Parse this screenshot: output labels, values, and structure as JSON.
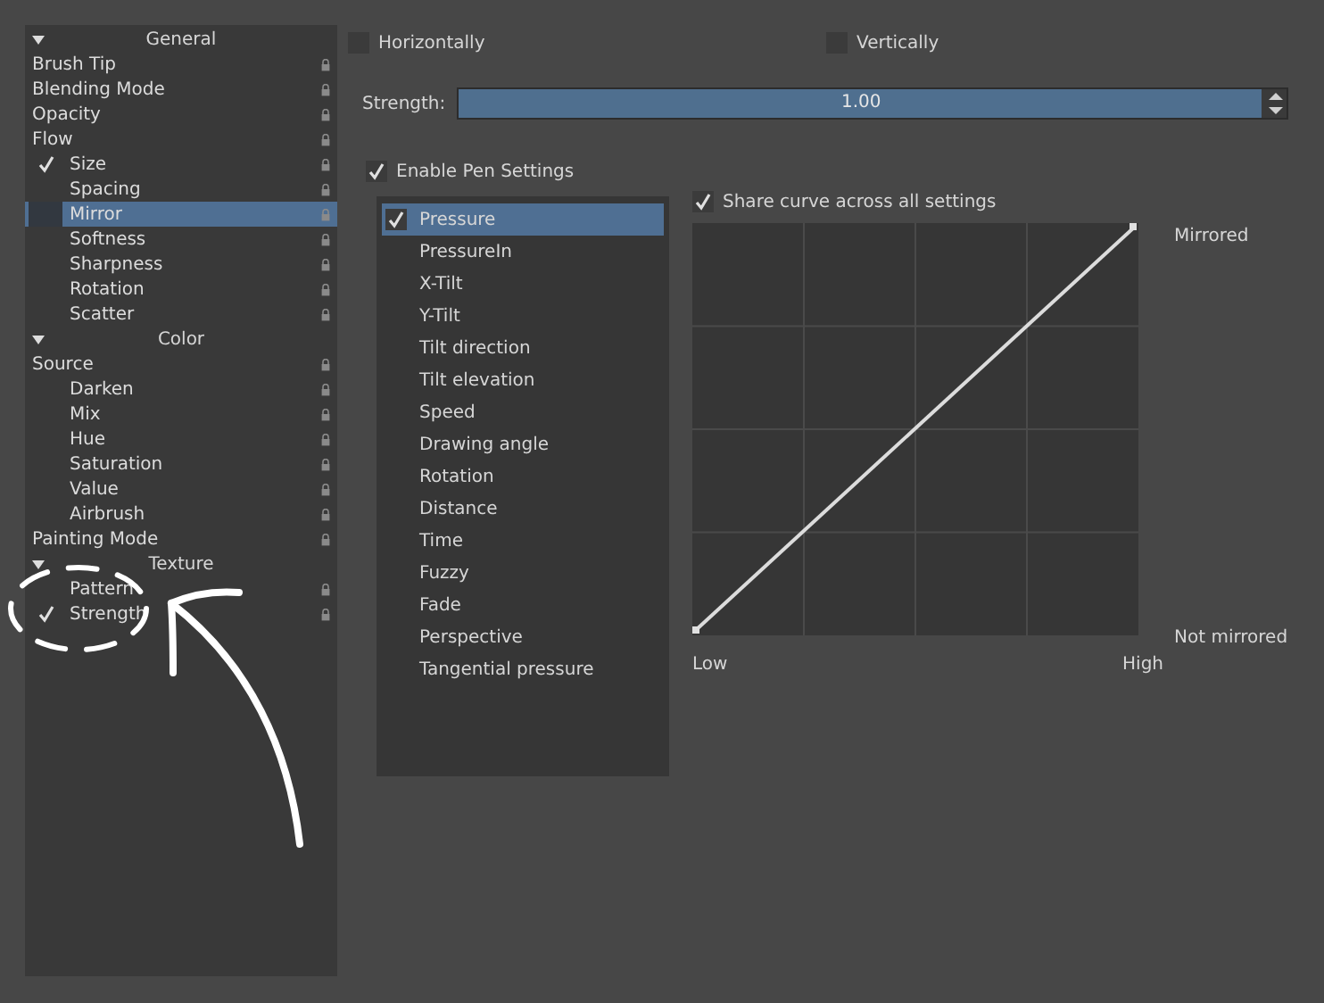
{
  "sidebar": {
    "sections": [
      {
        "title": "General",
        "expanded": true,
        "items": [
          {
            "label": "Brush Tip",
            "kind": "option",
            "selected": false
          },
          {
            "label": "Blending Mode",
            "kind": "option",
            "selected": false
          },
          {
            "label": "Opacity",
            "kind": "option",
            "selected": false
          },
          {
            "label": "Flow",
            "kind": "option",
            "selected": false
          },
          {
            "label": "Size",
            "kind": "check",
            "checked": true,
            "selected": false
          },
          {
            "label": "Spacing",
            "kind": "check",
            "checked": false,
            "selected": false
          },
          {
            "label": "Mirror",
            "kind": "check",
            "checked": false,
            "selected": true
          },
          {
            "label": "Softness",
            "kind": "check",
            "checked": false,
            "selected": false
          },
          {
            "label": "Sharpness",
            "kind": "check",
            "checked": false,
            "selected": false
          },
          {
            "label": "Rotation",
            "kind": "check",
            "checked": false,
            "selected": false
          },
          {
            "label": "Scatter",
            "kind": "check",
            "checked": false,
            "selected": false
          }
        ]
      },
      {
        "title": "Color",
        "expanded": true,
        "items": [
          {
            "label": "Source",
            "kind": "option",
            "selected": false
          },
          {
            "label": "Darken",
            "kind": "check",
            "checked": false,
            "selected": false
          },
          {
            "label": "Mix",
            "kind": "check",
            "checked": false,
            "selected": false
          },
          {
            "label": "Hue",
            "kind": "check",
            "checked": false,
            "selected": false
          },
          {
            "label": "Saturation",
            "kind": "check",
            "checked": false,
            "selected": false
          },
          {
            "label": "Value",
            "kind": "check",
            "checked": false,
            "selected": false
          },
          {
            "label": "Airbrush",
            "kind": "check",
            "checked": false,
            "selected": false
          },
          {
            "label": "Painting Mode",
            "kind": "option",
            "selected": false
          }
        ]
      },
      {
        "title": "Texture",
        "expanded": true,
        "items": [
          {
            "label": "Pattern",
            "kind": "check",
            "checked": false,
            "selected": false
          },
          {
            "label": "Strength",
            "kind": "check",
            "checked": true,
            "selected": false
          }
        ]
      }
    ]
  },
  "mirror": {
    "horizontally": {
      "label": "Horizontally",
      "checked": false
    },
    "vertically": {
      "label": "Vertically",
      "checked": false
    }
  },
  "strength": {
    "label": "Strength:",
    "value": "1.00",
    "level": 1
  },
  "pen_settings": {
    "label": "Enable Pen Settings",
    "checked": true
  },
  "sensors": [
    {
      "label": "Pressure",
      "checked": true,
      "selected": true
    },
    {
      "label": "PressureIn",
      "checked": false,
      "selected": false
    },
    {
      "label": "X-Tilt",
      "checked": false,
      "selected": false
    },
    {
      "label": "Y-Tilt",
      "checked": false,
      "selected": false
    },
    {
      "label": "Tilt direction",
      "checked": false,
      "selected": false
    },
    {
      "label": "Tilt elevation",
      "checked": false,
      "selected": false
    },
    {
      "label": "Speed",
      "checked": false,
      "selected": false
    },
    {
      "label": "Drawing angle",
      "checked": false,
      "selected": false
    },
    {
      "label": "Rotation",
      "checked": false,
      "selected": false
    },
    {
      "label": "Distance",
      "checked": false,
      "selected": false
    },
    {
      "label": "Time",
      "checked": false,
      "selected": false
    },
    {
      "label": "Fuzzy",
      "checked": false,
      "selected": false
    },
    {
      "label": "Fade",
      "checked": false,
      "selected": false
    },
    {
      "label": "Perspective",
      "checked": false,
      "selected": false
    },
    {
      "label": "Tangential pressure",
      "checked": false,
      "selected": false
    }
  ],
  "share_curve": {
    "label": "Share curve across all settings",
    "checked": true
  },
  "curve": {
    "top_label": "Mirrored",
    "bottom_label": "Not mirrored",
    "low_label": "Low",
    "high_label": "High"
  }
}
